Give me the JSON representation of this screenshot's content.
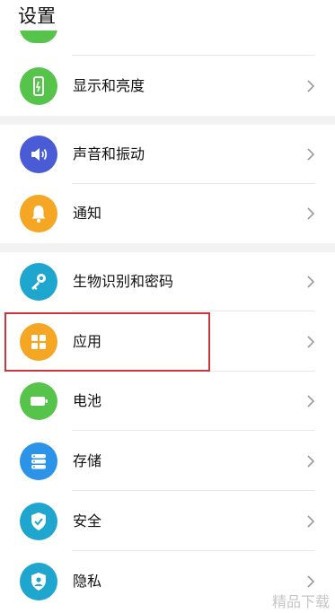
{
  "page_title": "设置",
  "colors": {
    "display": "#56c44a",
    "sound": "#4a5bd6",
    "notify": "#f5a623",
    "biometric": "#1fa6cf",
    "apps": "#f5a623",
    "battery": "#56c44a",
    "storage": "#2b94e8",
    "security": "#1fa6cf",
    "privacy": "#1fa6cf",
    "highlight": "#c8373d"
  },
  "items": [
    {
      "label": "显示和亮度",
      "icon": "phone-display-icon"
    },
    {
      "label": "声音和振动",
      "icon": "speaker-icon"
    },
    {
      "label": "通知",
      "icon": "bell-icon"
    },
    {
      "label": "生物识别和密码",
      "icon": "key-icon"
    },
    {
      "label": "应用",
      "icon": "app-grid-icon"
    },
    {
      "label": "电池",
      "icon": "battery-icon"
    },
    {
      "label": "存储",
      "icon": "storage-icon"
    },
    {
      "label": "安全",
      "icon": "shield-check-icon"
    },
    {
      "label": "隐私",
      "icon": "shield-person-icon"
    }
  ],
  "watermark": "精品下载"
}
